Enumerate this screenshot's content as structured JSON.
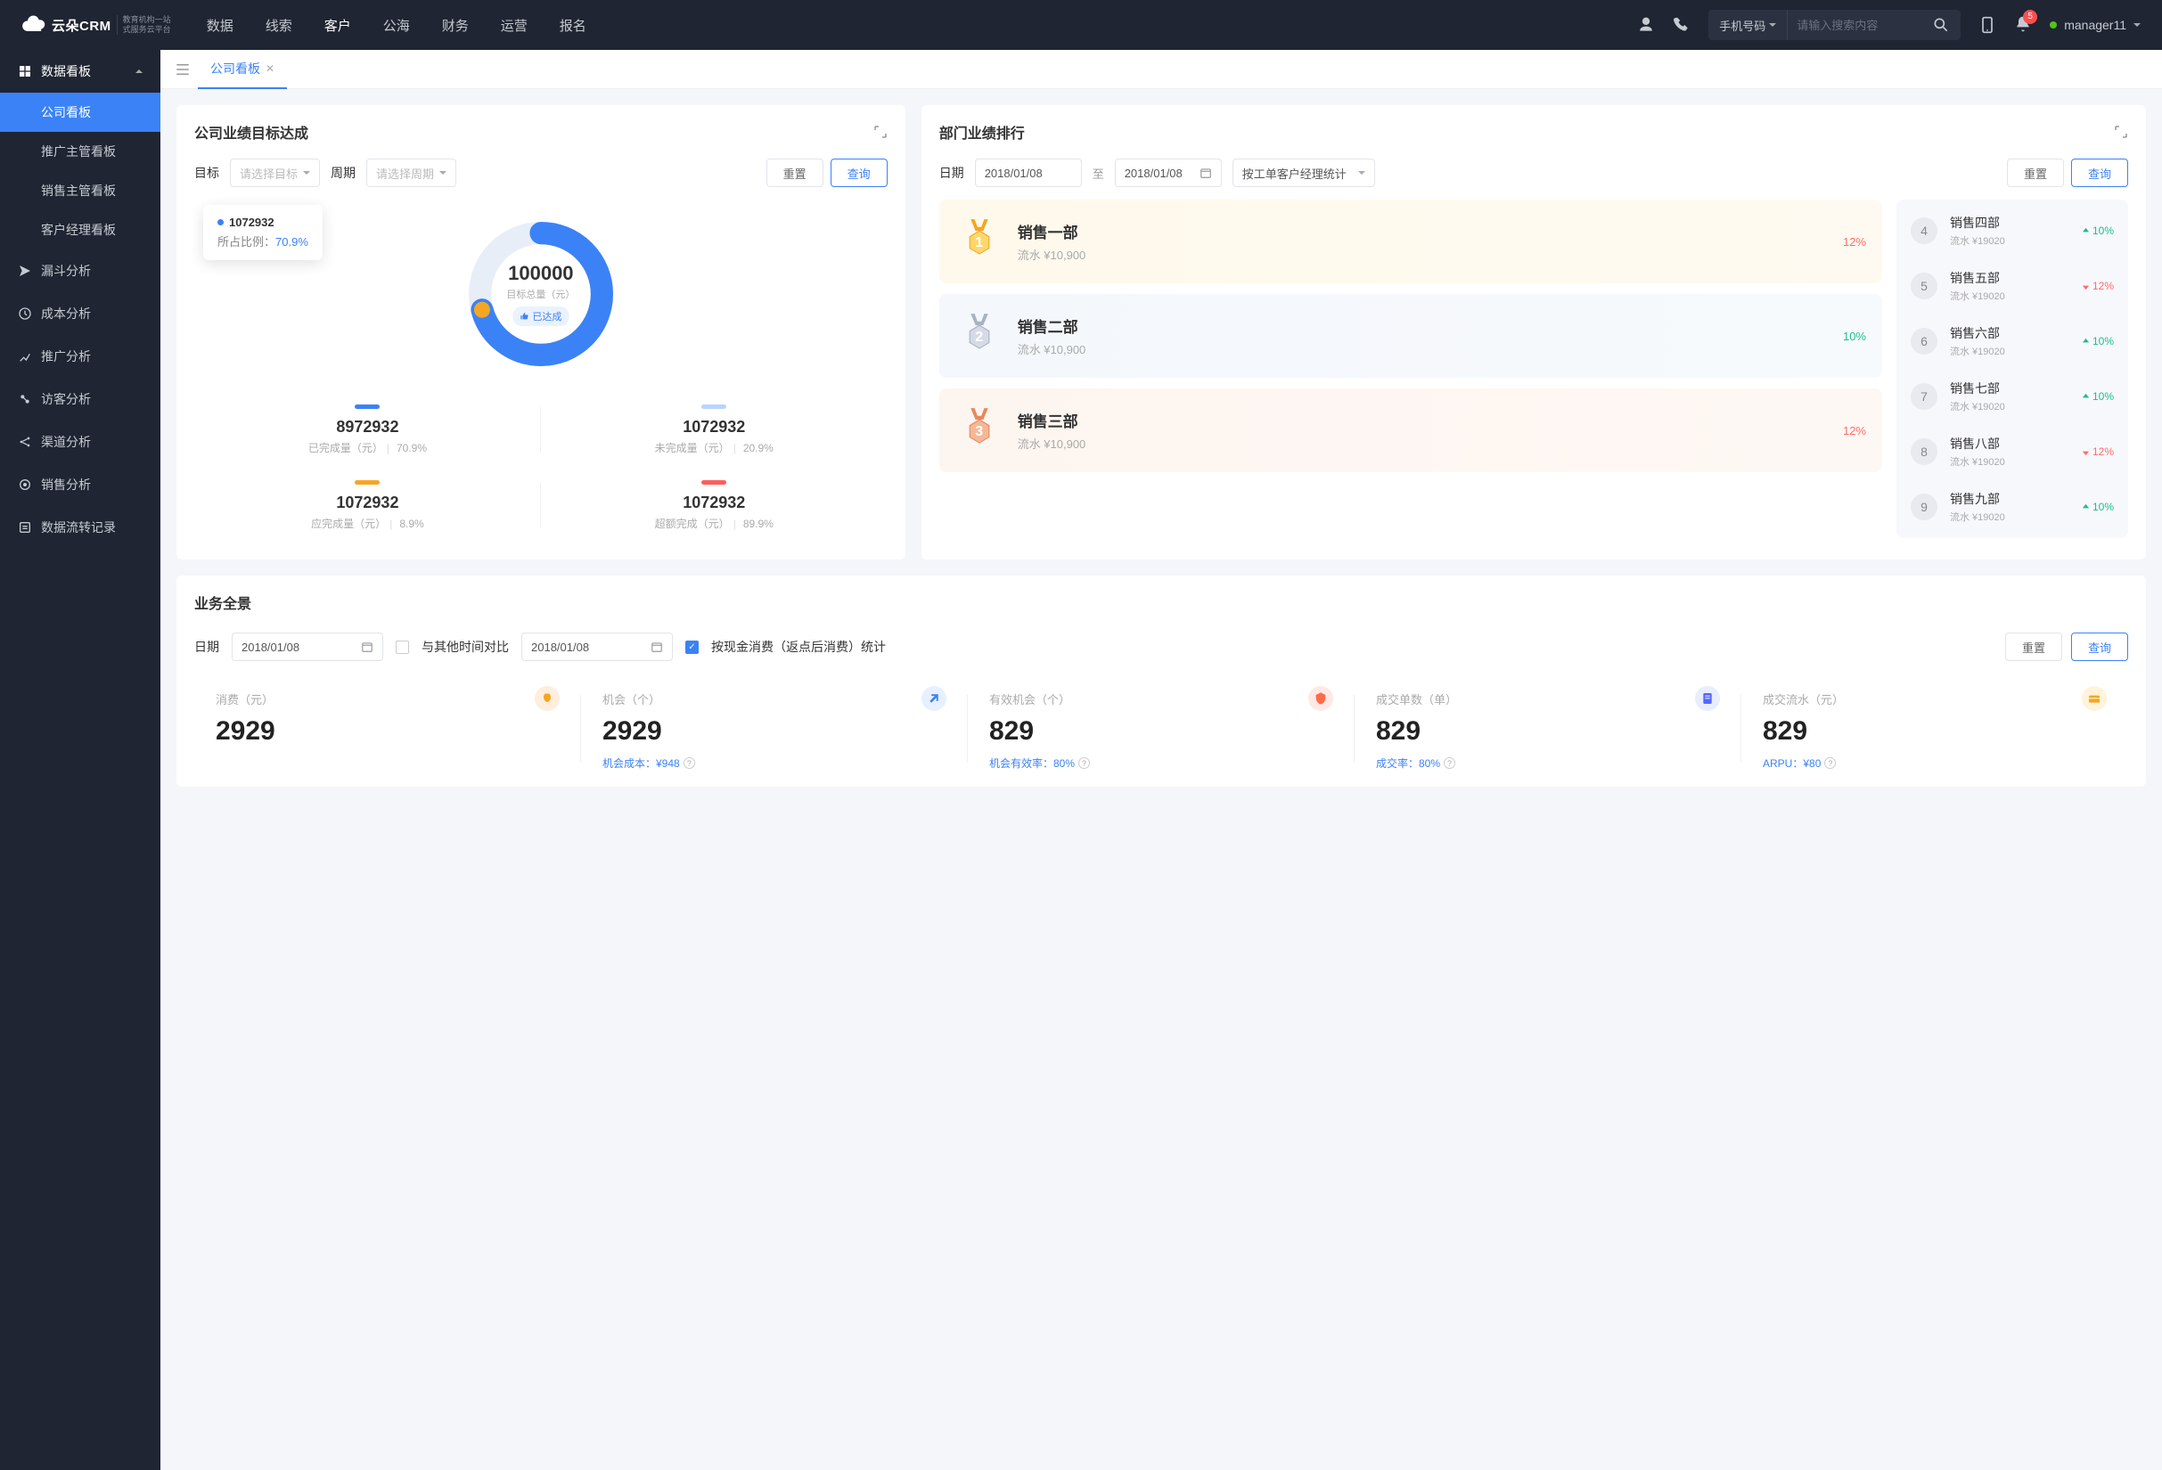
{
  "app": {
    "logo_main": "云朵CRM",
    "logo_sub1": "教育机构一站",
    "logo_sub2": "式服务云平台"
  },
  "topnav": [
    "数据",
    "线索",
    "客户",
    "公海",
    "财务",
    "运营",
    "报名"
  ],
  "topnav_active": 2,
  "search": {
    "selector": "手机号码",
    "placeholder": "请输入搜索内容"
  },
  "notif_count": "5",
  "username": "manager11",
  "sidebar": {
    "group_title": "数据看板",
    "subs": [
      "公司看板",
      "推广主管看板",
      "销售主管看板",
      "客户经理看板"
    ],
    "sub_active": 0,
    "items": [
      "漏斗分析",
      "成本分析",
      "推广分析",
      "访客分析",
      "渠道分析",
      "销售分析",
      "数据流转记录"
    ]
  },
  "tab": {
    "label": "公司看板"
  },
  "target": {
    "title": "公司业绩目标达成",
    "filters": {
      "target_label": "目标",
      "target_placeholder": "请选择目标",
      "period_label": "周期",
      "period_placeholder": "请选择周期",
      "reset": "重置",
      "query": "查询"
    },
    "donut": {
      "total": "100000",
      "total_label": "目标总量（元）",
      "reached_label": "已达成"
    },
    "tooltip": {
      "value": "1072932",
      "ratio_label": "所占比例：",
      "ratio": "70.9%"
    },
    "stats": [
      {
        "color": "#3b82f6",
        "num": "8972932",
        "label": "已完成量（元）",
        "pct": "70.9%"
      },
      {
        "color": "#b9d4ff",
        "num": "1072932",
        "label": "未完成量（元）",
        "pct": "20.9%"
      },
      {
        "color": "#f5a623",
        "num": "1072932",
        "label": "应完成量（元）",
        "pct": "8.9%"
      },
      {
        "color": "#ff5c5c",
        "num": "1072932",
        "label": "超额完成（元）",
        "pct": "89.9%"
      }
    ]
  },
  "rank": {
    "title": "部门业绩排行",
    "filters": {
      "date_label": "日期",
      "date_from": "2018/01/08",
      "sep": "至",
      "date_to": "2018/01/08",
      "stat_by": "按工单客户经理统计",
      "reset": "重置",
      "query": "查询"
    },
    "top3": [
      {
        "rank": "1",
        "name": "销售一部",
        "sub": "流水 ¥10,900",
        "delta": "12%",
        "dir": "down"
      },
      {
        "rank": "2",
        "name": "销售二部",
        "sub": "流水 ¥10,900",
        "delta": "10%",
        "dir": "up"
      },
      {
        "rank": "3",
        "name": "销售三部",
        "sub": "流水 ¥10,900",
        "delta": "12%",
        "dir": "down"
      }
    ],
    "rest": [
      {
        "rank": "4",
        "name": "销售四部",
        "sub": "流水 ¥19020",
        "delta": "10%",
        "dir": "up"
      },
      {
        "rank": "5",
        "name": "销售五部",
        "sub": "流水 ¥19020",
        "delta": "12%",
        "dir": "down"
      },
      {
        "rank": "6",
        "name": "销售六部",
        "sub": "流水 ¥19020",
        "delta": "10%",
        "dir": "up"
      },
      {
        "rank": "7",
        "name": "销售七部",
        "sub": "流水 ¥19020",
        "delta": "10%",
        "dir": "up"
      },
      {
        "rank": "8",
        "name": "销售八部",
        "sub": "流水 ¥19020",
        "delta": "12%",
        "dir": "down"
      },
      {
        "rank": "9",
        "name": "销售九部",
        "sub": "流水 ¥19020",
        "delta": "10%",
        "dir": "up"
      }
    ]
  },
  "overview": {
    "title": "业务全景",
    "filters": {
      "date_label": "日期",
      "date1": "2018/01/08",
      "compare_label": "与其他时间对比",
      "date2": "2018/01/08",
      "stat_by": "按现金消费（返点后消费）统计",
      "reset": "重置",
      "query": "查询"
    },
    "kpis": [
      {
        "label": "消费（元）",
        "num": "2929",
        "foot": "",
        "icon_bg": "#fdeedd",
        "icon_fill": "#f5a623"
      },
      {
        "label": "机会（个）",
        "num": "2929",
        "foot": "机会成本：¥948",
        "icon_bg": "#e6f0ff",
        "icon_fill": "#3b82f6"
      },
      {
        "label": "有效机会（个）",
        "num": "829",
        "foot": "机会有效率：80%",
        "icon_bg": "#ffe9e5",
        "icon_fill": "#ff6b4a"
      },
      {
        "label": "成交单数（单）",
        "num": "829",
        "foot": "成交率：80%",
        "icon_bg": "#e8edff",
        "icon_fill": "#5468ff"
      },
      {
        "label": "成交流水（元）",
        "num": "829",
        "foot": "ARPU：¥80",
        "icon_bg": "#fff3d9",
        "icon_fill": "#f5a623"
      }
    ]
  },
  "chart_data": {
    "type": "pie",
    "title": "公司业绩目标达成",
    "total_label": "目标总量（元）",
    "total": 100000,
    "series": [
      {
        "name": "已完成量（元）",
        "value": 8972932,
        "pct": 70.9,
        "color": "#3b82f6"
      },
      {
        "name": "未完成量（元）",
        "value": 1072932,
        "pct": 20.9,
        "color": "#b9d4ff"
      },
      {
        "name": "应完成量（元）",
        "value": 1072932,
        "pct": 8.9,
        "color": "#f5a623"
      },
      {
        "name": "超额完成（元）",
        "value": 1072932,
        "pct": 89.9,
        "color": "#ff5c5c"
      }
    ],
    "highlighted": {
      "value": 1072932,
      "pct": 70.9
    }
  }
}
